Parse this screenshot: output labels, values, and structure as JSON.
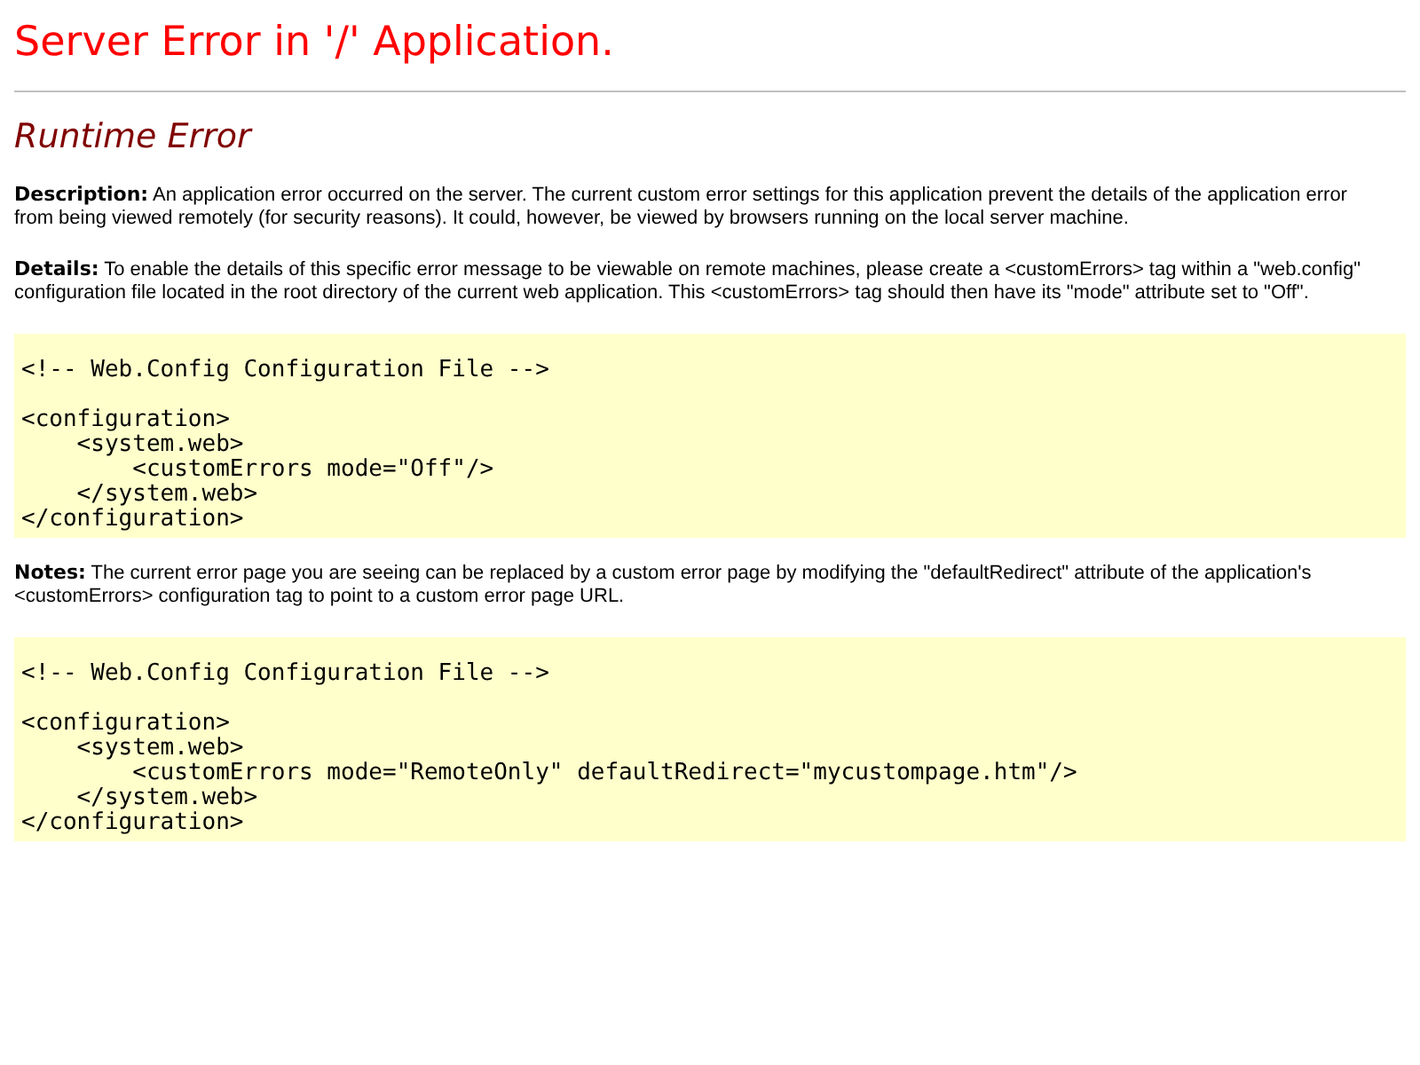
{
  "title": "Server Error in '/' Application.",
  "error_type": "Runtime Error",
  "description": "**Description:** An application error occurred on the server. The current custom error settings for this application prevent the details of the application error from being viewed remotely (for security reasons). It could, however, be viewed by browsers running on the local server machine.",
  "details": "**Details:** To enable the details of this specific error message to be viewable on remote machines, please create a <customErrors> tag within a \"web.config\" configuration file located in the root directory of the current web application. This <customErrors> tag should then have its \"mode\" attribute set to \"Off\".",
  "code_1": {
    "comment": "<!-- Web.Config Configuration File -->",
    "lines": [
      "<configuration>",
      "    <system.web>",
      "        <customErrors mode=\"Off\"/>",
      "    </system.web>",
      "</configuration>"
    ]
  },
  "notes": "**Notes:** The current error page you are seeing can be replaced by a custom error page by modifying the \"defaultRedirect\" attribute of the application's <customErrors> configuration tag to point to a custom error page URL.",
  "code_2": {
    "comment": "<!-- Web.Config Configuration File -->",
    "lines": [
      "<configuration>",
      "    <system.web>",
      "        <customErrors mode=\"RemoteOnly\" defaultRedirect=\"mycustompage.htm\"/>",
      "    </system.web>",
      "</configuration>"
    ]
  }
}
